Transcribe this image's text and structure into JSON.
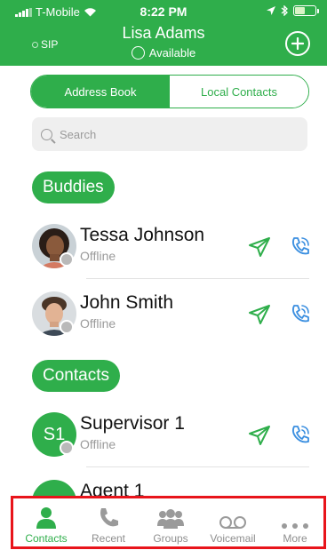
{
  "status_bar": {
    "carrier": "T-Mobile",
    "time": "8:22 PM"
  },
  "header": {
    "sip_label": "SIP",
    "user_name": "Lisa Adams",
    "user_status": "Available",
    "add_icon": "add-circle-icon"
  },
  "segment": {
    "tabs": [
      {
        "label": "Address Book",
        "active": true
      },
      {
        "label": "Local Contacts",
        "active": false
      }
    ]
  },
  "search": {
    "placeholder": "Search"
  },
  "sections": {
    "buddies": {
      "title": "Buddies",
      "items": [
        {
          "name": "Tessa Johnson",
          "status": "Offline"
        },
        {
          "name": "John Smith",
          "status": "Offline"
        }
      ]
    },
    "contacts": {
      "title": "Contacts",
      "items": [
        {
          "initials": "S1",
          "name": "Supervisor 1",
          "status": "Offline"
        },
        {
          "name": "Agent 1"
        }
      ]
    }
  },
  "tabbar": {
    "tabs": [
      {
        "label": "Contacts",
        "icon": "person-icon",
        "active": true
      },
      {
        "label": "Recent",
        "icon": "phone-icon",
        "active": false
      },
      {
        "label": "Groups",
        "icon": "group-icon",
        "active": false
      },
      {
        "label": "Voicemail",
        "icon": "voicemail-icon",
        "active": false
      },
      {
        "label": "More",
        "icon": "more-dots-icon",
        "active": false
      }
    ]
  },
  "colors": {
    "brand_green": "#2fae4b",
    "highlight_red": "#e8141b",
    "presence_offline": "#b9b9b9",
    "call_blue": "#3b8fe0"
  }
}
